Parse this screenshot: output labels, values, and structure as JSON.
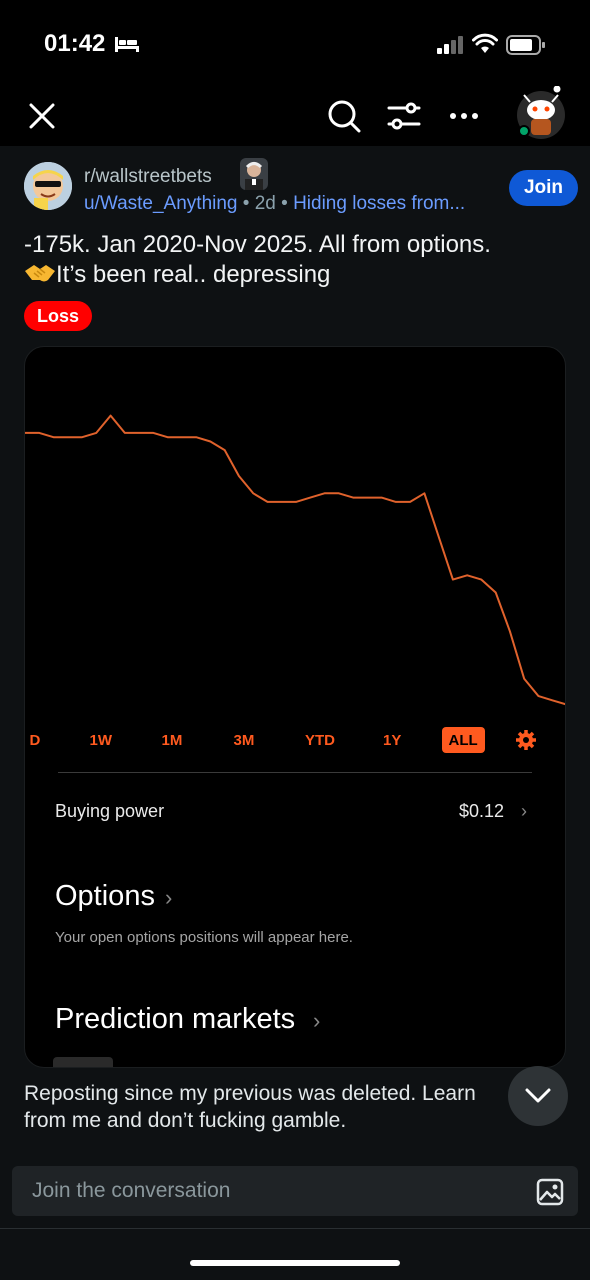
{
  "status_bar": {
    "time": "01:42",
    "icons": [
      "bed-icon",
      "cellular-signal-icon",
      "wifi-icon",
      "battery-icon"
    ]
  },
  "nav": {
    "icons": [
      "close-icon",
      "search-icon",
      "sort-filter-icon",
      "more-options-icon",
      "user-avatar"
    ]
  },
  "post": {
    "subreddit": "r/wallstreetbets",
    "author": "u/Waste_Anything",
    "separator": "•",
    "age": "2d",
    "flair_text": "Hiding losses from...",
    "join_label": "Join",
    "title_line_1": "-175k. Jan 2020-Nov 2025.  All from options.",
    "title_line_2": "It’s been real.. depressing",
    "title_emoji": "handshake-emoji",
    "tag": "Loss",
    "body_line_1": "Reposting since my previous was deleted. Learn",
    "body_line_2": "from me and don’t fucking gamble."
  },
  "screenshot": {
    "chart_data": {
      "type": "line",
      "title": "",
      "xlabel": "",
      "ylabel": "",
      "x_range": [
        "Jan 2020",
        "Nov 2025"
      ],
      "series": [
        {
          "color": "#e0622c",
          "values": [
            100,
            100,
            99,
            99,
            99,
            100,
            104,
            100,
            100,
            100,
            99,
            99,
            99,
            98,
            96,
            90,
            86,
            84,
            84,
            84,
            85,
            86,
            86,
            85,
            85,
            85,
            84,
            84,
            86,
            76,
            66,
            67,
            66,
            63,
            54,
            43,
            39,
            38,
            37
          ]
        }
      ]
    },
    "ranges": [
      "D",
      "1W",
      "1M",
      "3M",
      "YTD",
      "1Y",
      "ALL"
    ],
    "active_range": "ALL",
    "accent": "#ff5a1f",
    "buying_power_label": "Buying power",
    "buying_power_value": "$0.12",
    "options_title": "Options",
    "options_subtitle": "Your open options positions will appear here.",
    "prediction_title": "Prediction markets"
  },
  "composer": {
    "placeholder": "Join the conversation"
  },
  "colors": {
    "background": "#0e1113",
    "join_blue": "#0f59d6",
    "loss_red": "#ff0000",
    "link_blue": "#6b9cff"
  }
}
